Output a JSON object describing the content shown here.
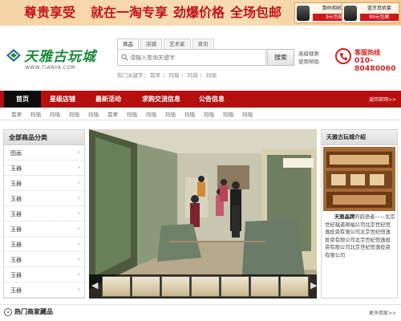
{
  "banner": {
    "promo": [
      "尊贵享受",
      "就在一淘专享",
      "劲爆价格",
      "全场包邮"
    ],
    "products": [
      {
        "name": "数码相机包",
        "price": "9元包邮"
      },
      {
        "name": "蓝牙耳机套",
        "price": "99元包邮"
      }
    ]
  },
  "header": {
    "logo_text": "天雅古玩城",
    "logo_url": "WWW.TIANYA.COM",
    "search_tabs": [
      "商品",
      "店铺",
      "艺术家",
      "资讯"
    ],
    "search_placeholder": "请输入查询关键字",
    "search_button": "搜索",
    "advanced_search": "高级搜索",
    "help": "使用帮助",
    "hot_label": "热门关键字：",
    "hot_keywords": [
      "翡翠",
      "玛瑙",
      "玛瑙",
      "玛瑙"
    ],
    "hotline_title": "客服热线",
    "hotline_number": "010-80480060"
  },
  "nav": {
    "items": [
      "首页",
      "星级店铺",
      "最新活动",
      "求购交流信息",
      "公告信息"
    ],
    "return_link": "返回官网>>"
  },
  "subnav": [
    "翡翠",
    "玛瑙",
    "玛瑙",
    "玛瑙",
    "玛瑙",
    "翡翠",
    "玛瑙",
    "玛瑙",
    "玛瑙",
    "玛瑙",
    "玛瑙",
    "玛瑙",
    "玛瑙"
  ],
  "categories": {
    "title": "全部商品分类",
    "items": [
      "图画",
      "玉器",
      "玉器",
      "玉器",
      "玉器",
      "玉器",
      "玉器",
      "玉器",
      "玉器",
      "玉器"
    ]
  },
  "intro": {
    "title": "天雅古玩城介绍",
    "lead": "天雅晶牌",
    "body": "的韵语者——北京世纪福道邮福公司北京世纪恒逸投资有限公司北京世纪恒逸投资有限公司北京世纪恒逸投资有限公司北京世纪恒逸投资有限公司"
  },
  "bottom": {
    "title": "热门商家藏品",
    "more": "更多商家>>"
  },
  "colors": {
    "brand_red": "#b50f0f",
    "logo_green": "#1c8a3a",
    "nav_active": "#0d0d0d"
  }
}
